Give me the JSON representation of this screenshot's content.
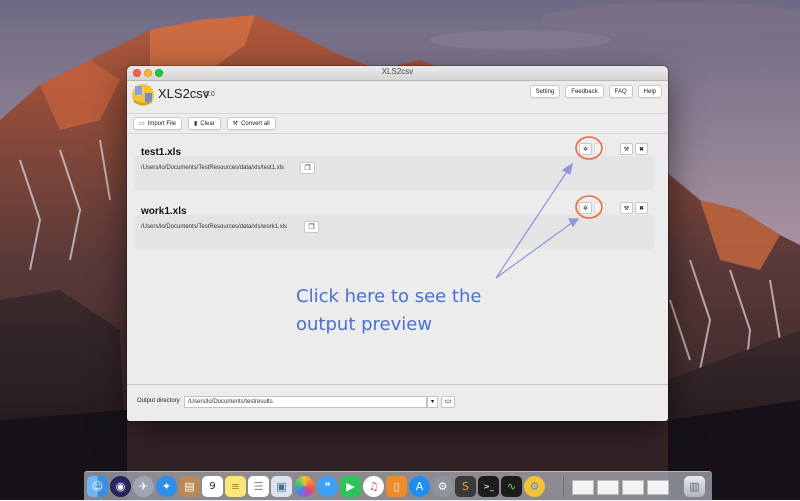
{
  "window": {
    "title": "XLS2csv"
  },
  "app": {
    "name": "XLS2csv",
    "version": "5.0"
  },
  "header_buttons": [
    "Setting",
    "Feedback",
    "FAQ",
    "Help"
  ],
  "toolbar": {
    "import_label": "Import File",
    "clear_label": "Clear",
    "convert_label": "Convert all"
  },
  "files": [
    {
      "name": "test1.xls",
      "path": "/Users/lo/Documents/TestResources/data/xls/test1.xls"
    },
    {
      "name": "work1.xls",
      "path": "/Users/lo/Documents/TestResources/data/xls/work1.xls"
    }
  ],
  "output": {
    "label": "Output directory",
    "value": "/Users/lo/Documents/testresults"
  },
  "annotation": {
    "line1": "Click here to see the",
    "line2": "output preview",
    "color": "#4a6fd0",
    "circle_color": "#ec6a3a"
  },
  "dock": {
    "calendar_day": "9",
    "icons": [
      "finder-icon",
      "siri-icon",
      "launchpad-icon",
      "safari-icon",
      "contacts-icon",
      "calendar-icon",
      "notes-icon",
      "reminders-icon",
      "preview-icon",
      "photos-icon",
      "messages-icon",
      "facetime-icon",
      "itunes-icon",
      "ibooks-icon",
      "app-store-icon",
      "system-preferences-icon",
      "sublime-icon",
      "terminal-icon",
      "activity-monitor-icon",
      "xls2csv-icon",
      "downloads-thumb-icon",
      "document-thumb-icon",
      "spreadsheet-thumb-icon",
      "spreadsheet-thumb-icon",
      "trash-icon"
    ]
  }
}
